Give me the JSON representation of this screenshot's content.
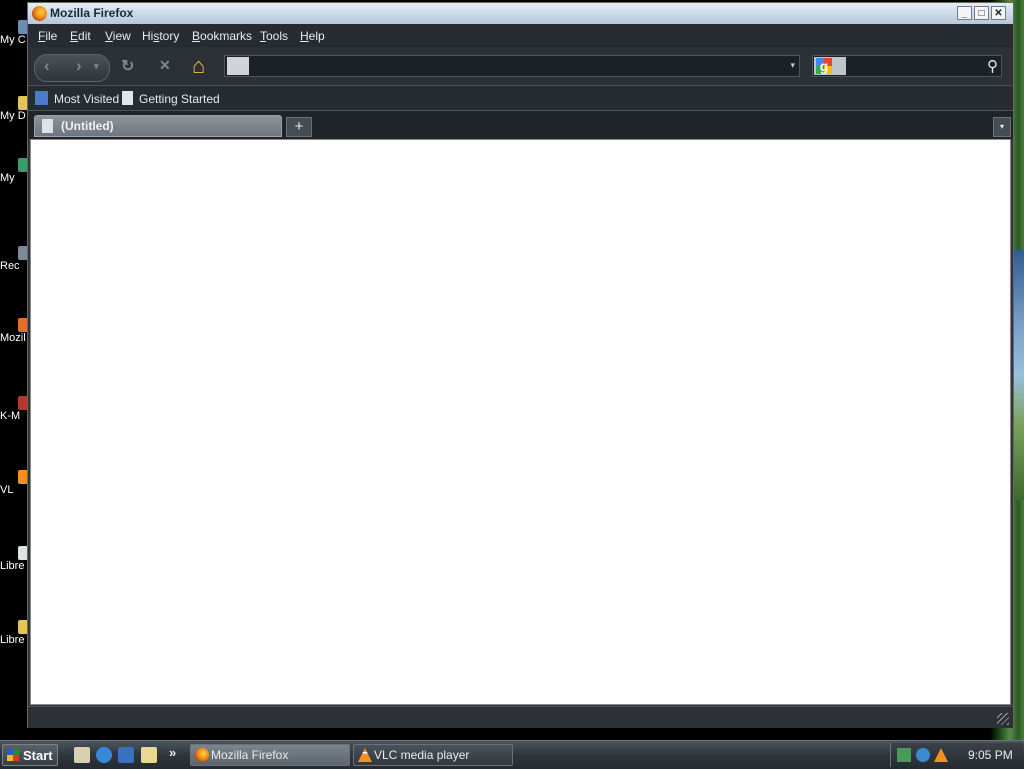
{
  "desktop": {
    "icons": [
      {
        "label": "My C",
        "name": "desktop-icon-my-computer"
      },
      {
        "label": "My D",
        "name": "desktop-icon-my-documents"
      },
      {
        "label": "My",
        "name": "desktop-icon-my-network"
      },
      {
        "label": "Rec",
        "name": "desktop-icon-recycle-bin"
      },
      {
        "label": "Mozil",
        "name": "desktop-icon-mozilla-firefox"
      },
      {
        "label": "K-M",
        "name": "desktop-icon-k-meleon"
      },
      {
        "label": "VL",
        "name": "desktop-icon-vlc"
      },
      {
        "label": "Libre",
        "name": "desktop-icon-libreoffice"
      },
      {
        "label": "Libre",
        "name": "desktop-icon-libreoffice-folder"
      }
    ]
  },
  "window": {
    "title": "Mozilla Firefox",
    "controls": {
      "minimize": "_",
      "maximize": "□",
      "close": "✕"
    }
  },
  "menubar": {
    "items": [
      {
        "label": "File",
        "accel": "F"
      },
      {
        "label": "Edit",
        "accel": "E"
      },
      {
        "label": "View",
        "accel": "V"
      },
      {
        "label": "History",
        "accel": "s"
      },
      {
        "label": "Bookmarks",
        "accel": "B"
      },
      {
        "label": "Tools",
        "accel": "T"
      },
      {
        "label": "Help",
        "accel": "H"
      }
    ]
  },
  "navbar": {
    "back_icon": "‹",
    "forward_icon": "›",
    "reload_icon": "↻",
    "stop_icon": "✕",
    "home_icon": "⌂",
    "url_value": "",
    "url_dropdown": "▾",
    "search_engine": "g",
    "search_value": "",
    "search_icon": "⚲"
  },
  "bookmarks": {
    "items": [
      {
        "label": "Most Visited"
      },
      {
        "label": "Getting Started"
      }
    ]
  },
  "tabs": {
    "items": [
      {
        "label": "(Untitled)"
      }
    ],
    "new_tab_label": "+",
    "list_all_label": "▾"
  },
  "taskbar": {
    "start_label": "Start",
    "quicklaunch_more": "»",
    "tasks": [
      {
        "label": "Mozilla Firefox",
        "active": true
      },
      {
        "label": "VLC media player",
        "active": false
      }
    ],
    "clock": "9:05 PM"
  },
  "colors": {
    "accent": "#2b3137",
    "titlebar": "#c7d8e8",
    "firefox_orange": "#f08a1a",
    "vlc_orange": "#f5901e"
  }
}
